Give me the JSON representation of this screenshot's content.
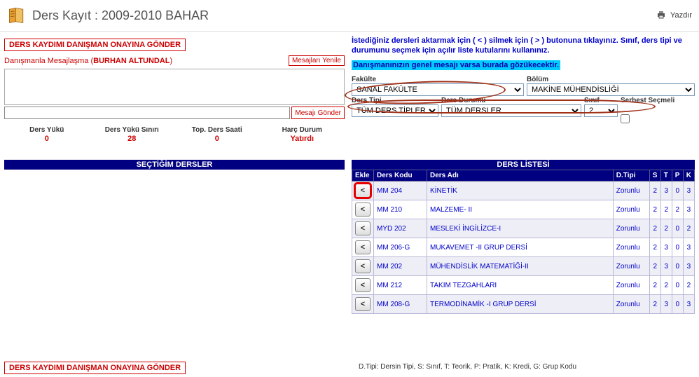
{
  "header": {
    "title": "Ders Kayıt : 2009-2010 BAHAR",
    "print_label": "Yazdır"
  },
  "submit_button": "DERS KAYDIMI DANIŞMAN ONAYINA GÖNDER",
  "advisor": {
    "label": "Danışmanla Mesajlaşma (",
    "name": "BURHAN ALTUNDAL",
    "close": ")"
  },
  "messages": {
    "refresh": "Mesajları Yenile",
    "send": "Mesajı Gönder",
    "input_placeholder": ""
  },
  "stats": {
    "load_label": "Ders Yükü",
    "load_val": "0",
    "limit_label": "Ders Yükü Sınırı",
    "limit_val": "28",
    "hours_label": "Top. Ders Saati",
    "hours_val": "0",
    "fee_label": "Harç Durum",
    "fee_val": "Yatırdı"
  },
  "info": {
    "line": "İstediğiniz dersleri aktarmak için ( < ) silmek için ( > ) butonuna tıklayınız. Sınıf, ders tipi ve durumunu seçmek için açılır liste kutularını kullanınız.",
    "highlight": "Danışmanınızın genel mesajı varsa burada gözükecektir."
  },
  "filters": {
    "faculty_label": "Fakülte",
    "faculty_val": "SANAL FAKÜLTE",
    "dept_label": "Bölüm",
    "dept_val": "MAKİNE MÜHENDİSLİĞİ",
    "type_label": "Ders Tipi",
    "type_val": "TÜM DERS TİPLERİ",
    "status_label": "Ders Durumu",
    "status_val": "TÜM DERSLER",
    "year_label": "Sınıf",
    "year_val": "2",
    "elective_label": "Serbest Seçmeli"
  },
  "left_section_title": "SEÇTİĞİM DERSLER",
  "right_section_title": "DERS LİSTESİ",
  "table": {
    "headers": {
      "add": "Ekle",
      "code": "Ders Kodu",
      "name": "Ders Adı",
      "type": "D.Tipi",
      "s": "S",
      "t": "T",
      "p": "P",
      "k": "K"
    },
    "rows": [
      {
        "code": "MM 204",
        "name": "KİNETİK",
        "type": "Zorunlu",
        "s": "2",
        "t": "3",
        "p": "0",
        "k": "3"
      },
      {
        "code": "MM 210",
        "name": "MALZEME- II",
        "type": "Zorunlu",
        "s": "2",
        "t": "2",
        "p": "2",
        "k": "3"
      },
      {
        "code": "MYD 202",
        "name": "MESLEKİ İNGİLİZCE-I",
        "type": "Zorunlu",
        "s": "2",
        "t": "2",
        "p": "0",
        "k": "2"
      },
      {
        "code": "MM 206-G",
        "name": "MUKAVEMET -II GRUP DERSİ",
        "type": "Zorunlu",
        "s": "2",
        "t": "3",
        "p": "0",
        "k": "3"
      },
      {
        "code": "MM 202",
        "name": "MÜHENDİSLİK MATEMATİĞİ-II",
        "type": "Zorunlu",
        "s": "2",
        "t": "3",
        "p": "0",
        "k": "3"
      },
      {
        "code": "MM 212",
        "name": "TAKIM TEZGAHLARI",
        "type": "Zorunlu",
        "s": "2",
        "t": "2",
        "p": "0",
        "k": "2"
      },
      {
        "code": "MM 208-G",
        "name": "TERMODİNAMİK -I GRUP DERSİ",
        "type": "Zorunlu",
        "s": "2",
        "t": "3",
        "p": "0",
        "k": "3"
      }
    ]
  },
  "footer_legend": "D.Tipi: Dersin Tipi, S: Sınıf, T: Teorik, P: Pratik, K: Kredi, G: Grup Kodu",
  "add_icon": "<"
}
